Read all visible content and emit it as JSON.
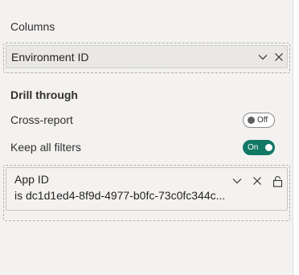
{
  "columns": {
    "label": "Columns",
    "fields": [
      {
        "label": "Environment ID"
      }
    ]
  },
  "drill_through": {
    "heading": "Drill through",
    "cross_report": {
      "label": "Cross-report",
      "state": "Off"
    },
    "keep_all_filters": {
      "label": "Keep all filters",
      "state": "On"
    }
  },
  "filter": {
    "title": "App ID",
    "value": "is dc1d1ed4-8f9d-4977-b0fc-73c0fc344c..."
  },
  "colors": {
    "toggle_on": "#117865",
    "panel_bg": "#f3f2f1"
  },
  "icons": [
    "chevron-down-icon",
    "close-icon",
    "lock-icon"
  ]
}
